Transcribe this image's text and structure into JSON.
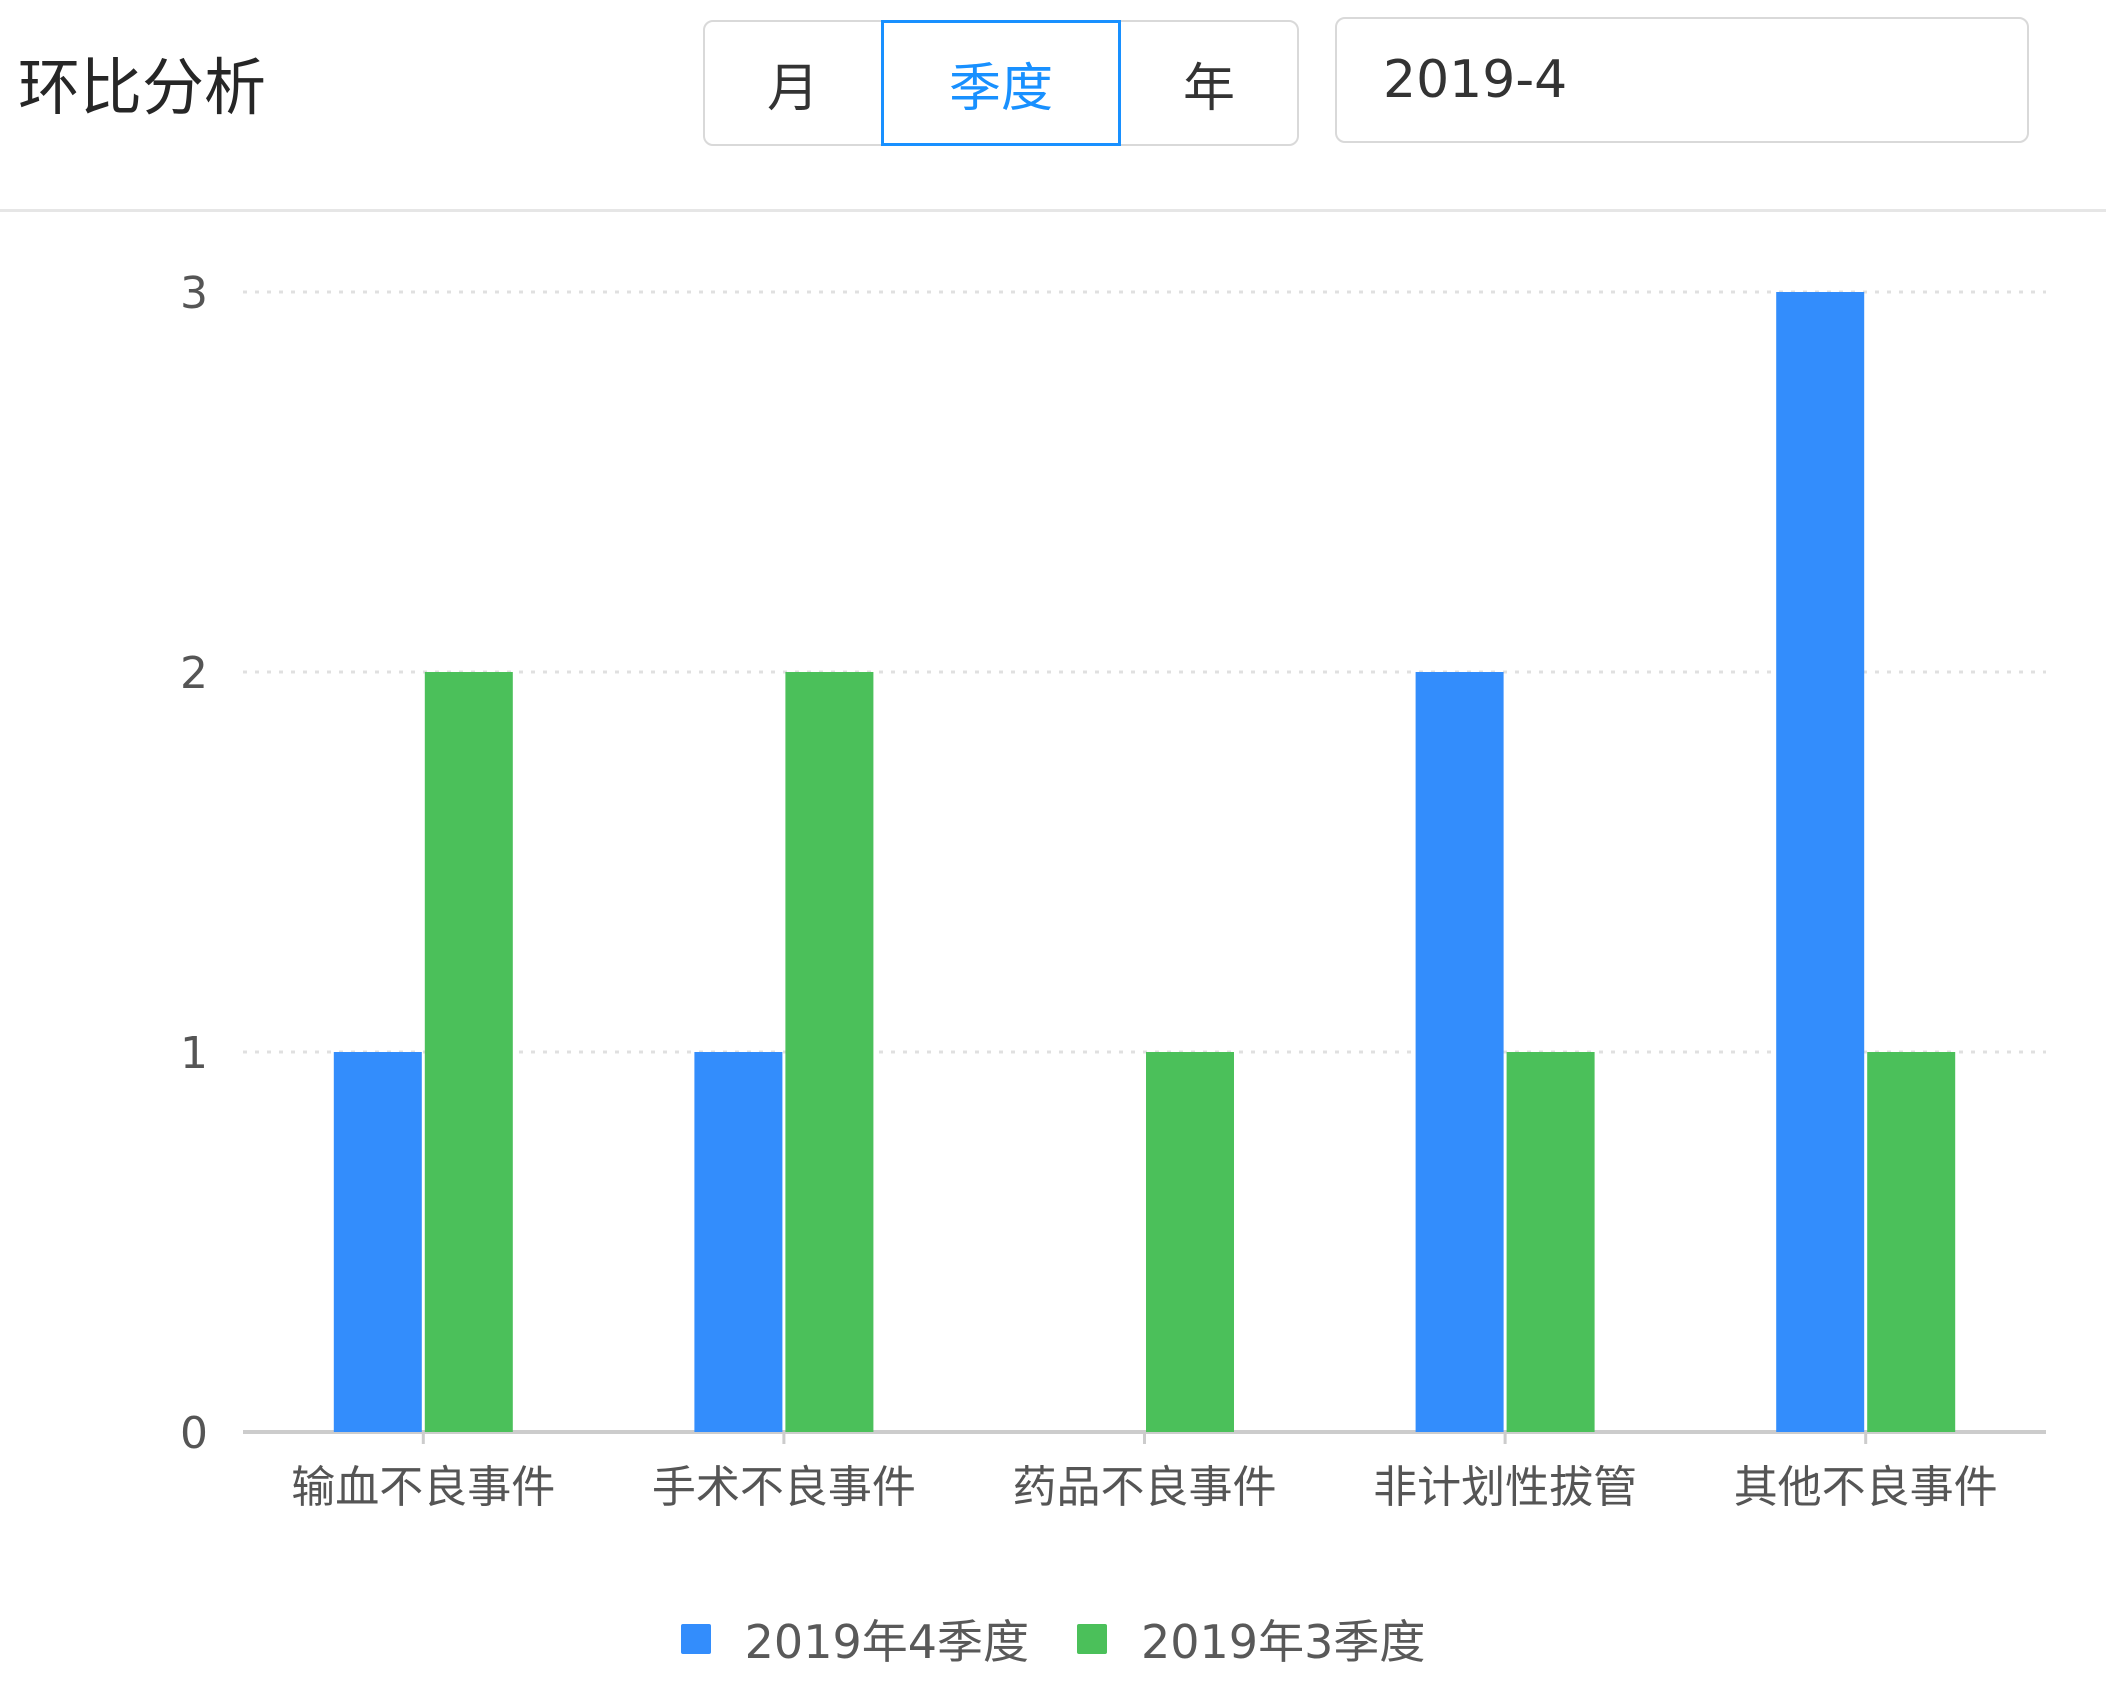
{
  "header": {
    "title": "环比分析",
    "segments": [
      {
        "label": "月",
        "active": false
      },
      {
        "label": "季度",
        "active": true
      },
      {
        "label": "年",
        "active": false
      }
    ],
    "date_value": "2019-4",
    "date_icon": "calendar-icon"
  },
  "colors": {
    "accent": "#1890ff",
    "series_1": "#338dfc",
    "series_2": "#4bc05a",
    "grid": "#e0e0e0",
    "axis": "#cccccc"
  },
  "chart_data": {
    "type": "bar",
    "categories": [
      "输血不良事件",
      "手术不良事件",
      "药品不良事件",
      "非计划性拔管",
      "其他不良事件"
    ],
    "series": [
      {
        "name": "2019年4季度",
        "values": [
          1,
          1,
          0,
          2,
          3
        ]
      },
      {
        "name": "2019年3季度",
        "values": [
          2,
          2,
          1,
          1,
          1
        ]
      }
    ],
    "yticks": [
      "0",
      "1",
      "2",
      "3"
    ],
    "ylim": [
      0,
      3
    ],
    "grid": true,
    "legend": "bottom-center"
  }
}
